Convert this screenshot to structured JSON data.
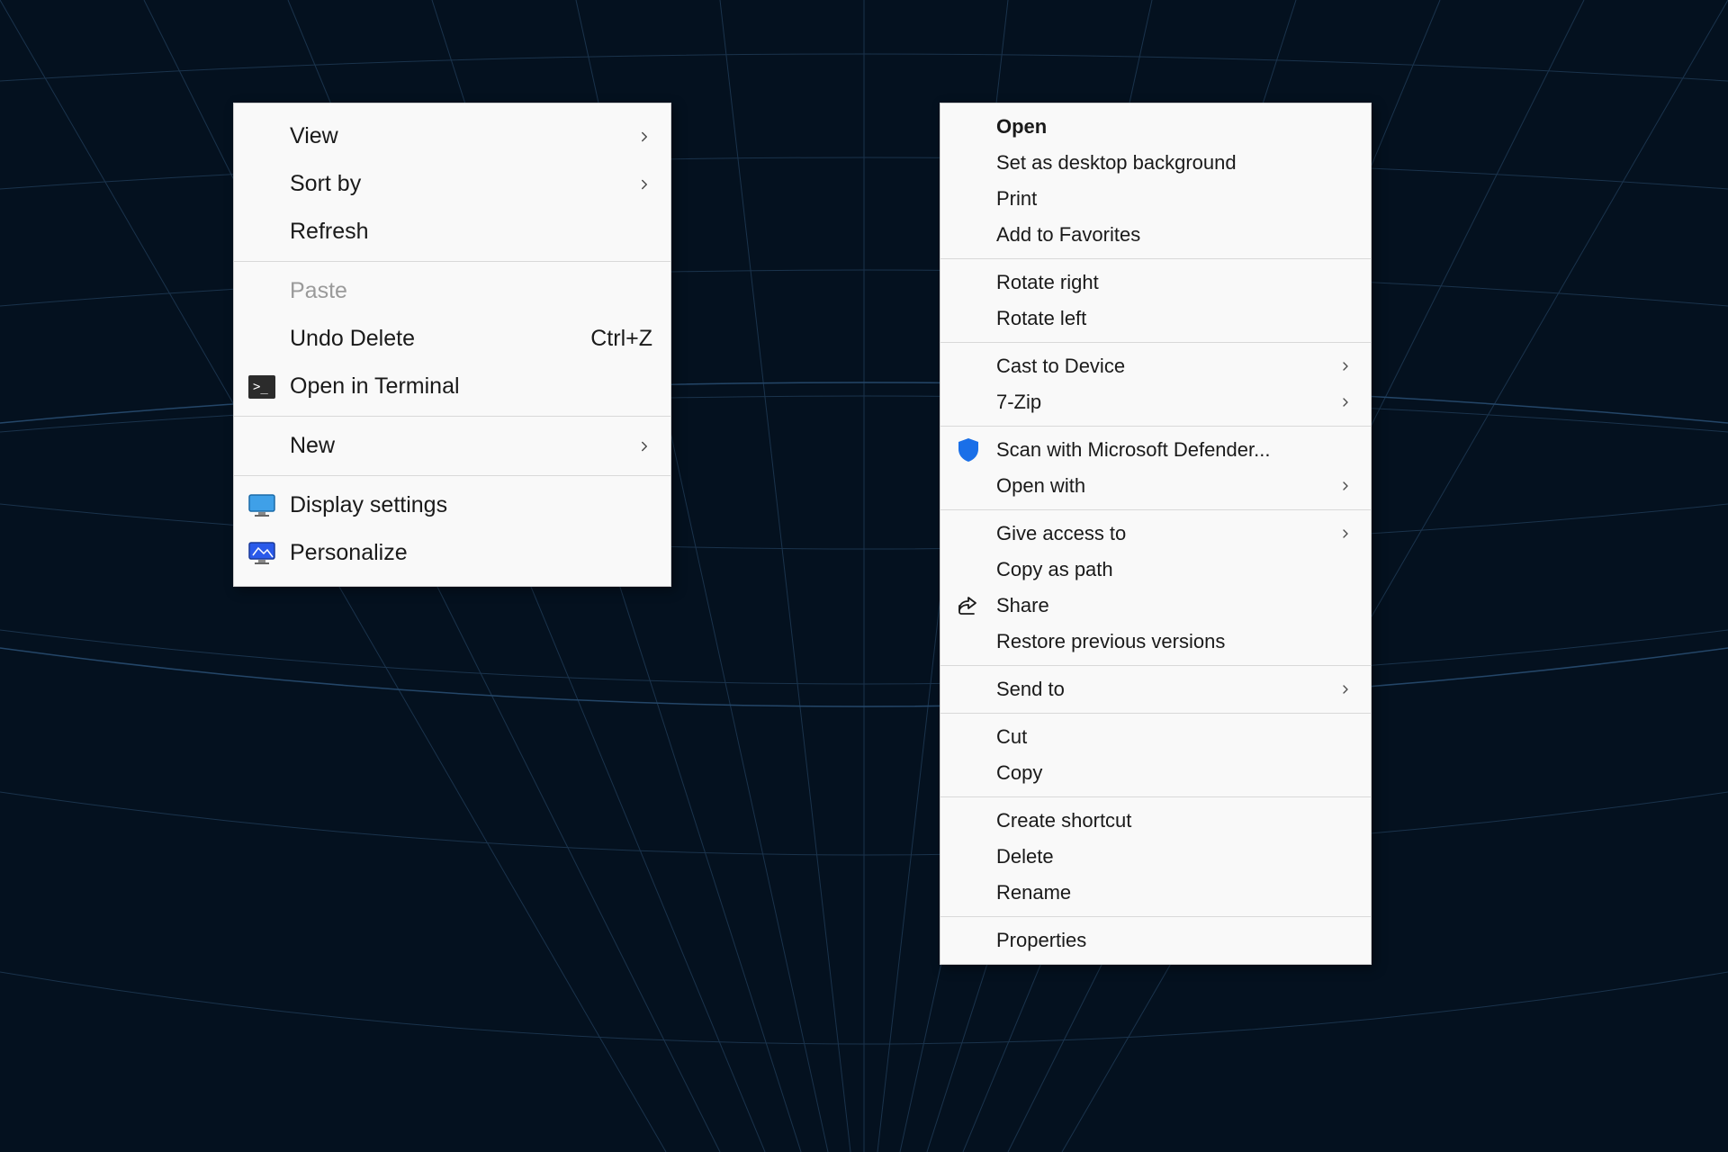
{
  "leftMenu": {
    "group1": {
      "view": "View",
      "sortBy": "Sort by",
      "refresh": "Refresh"
    },
    "group2": {
      "paste": "Paste",
      "undoDelete": "Undo Delete",
      "undoDeleteShortcut": "Ctrl+Z",
      "openInTerminal": "Open in Terminal"
    },
    "group3": {
      "new": "New"
    },
    "group4": {
      "displaySettings": "Display settings",
      "personalize": "Personalize"
    }
  },
  "rightMenu": {
    "group1": {
      "open": "Open",
      "setAsBackground": "Set as desktop background",
      "print": "Print",
      "addToFavorites": "Add to Favorites"
    },
    "group2": {
      "rotateRight": "Rotate right",
      "rotateLeft": "Rotate left"
    },
    "group3": {
      "castToDevice": "Cast to Device",
      "sevenZip": "7-Zip"
    },
    "group4": {
      "scanDefender": "Scan with Microsoft Defender...",
      "openWith": "Open with"
    },
    "group5": {
      "giveAccessTo": "Give access to",
      "copyAsPath": "Copy as path",
      "share": "Share",
      "restorePrevious": "Restore previous versions"
    },
    "group6": {
      "sendTo": "Send to"
    },
    "group7": {
      "cut": "Cut",
      "copy": "Copy"
    },
    "group8": {
      "createShortcut": "Create shortcut",
      "delete": "Delete",
      "rename": "Rename"
    },
    "group9": {
      "properties": "Properties"
    }
  }
}
